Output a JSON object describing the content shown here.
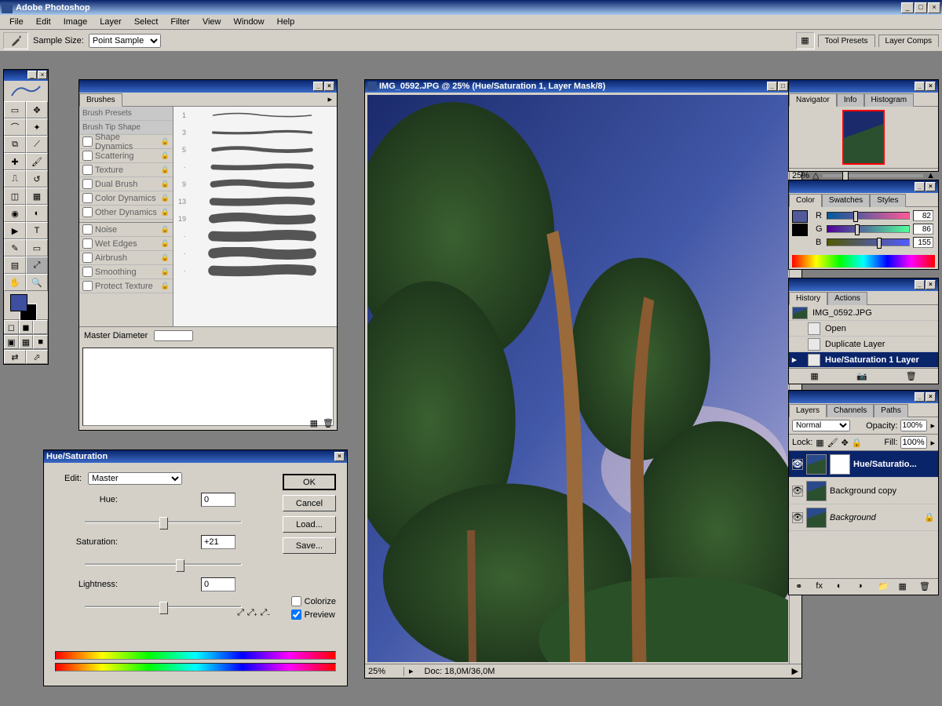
{
  "app": {
    "title": "Adobe Photoshop"
  },
  "menu": [
    "File",
    "Edit",
    "Image",
    "Layer",
    "Select",
    "Filter",
    "View",
    "Window",
    "Help"
  ],
  "optionsbar": {
    "sample_label": "Sample Size:",
    "sample_value": "Point Sample",
    "docked_tabs": [
      "Tool Presets",
      "Layer Comps"
    ]
  },
  "brushes": {
    "title": "Brushes",
    "presets_label": "Brush Presets",
    "tip_label": "Brush Tip Shape",
    "options": [
      "Shape Dynamics",
      "Scattering",
      "Texture",
      "Dual Brush",
      "Color Dynamics",
      "Other Dynamics"
    ],
    "options2": [
      "Noise",
      "Wet Edges",
      "Airbrush",
      "Smoothing",
      "Protect Texture"
    ],
    "sizes": [
      1,
      3,
      5,
      "·",
      9,
      13,
      19,
      "·",
      "·",
      "·"
    ],
    "master_label": "Master Diameter"
  },
  "document": {
    "title": "IMG_0592.JPG @ 25% (Hue/Saturation 1, Layer Mask/8)",
    "zoom": "25%",
    "docinfo": "Doc: 18,0M/36,0M"
  },
  "huesat": {
    "title": "Hue/Saturation",
    "edit_label": "Edit:",
    "edit_value": "Master",
    "hue_label": "Hue:",
    "hue_value": "0",
    "sat_label": "Saturation:",
    "sat_value": "+21",
    "light_label": "Lightness:",
    "light_value": "0",
    "ok": "OK",
    "cancel": "Cancel",
    "load": "Load...",
    "save": "Save...",
    "colorize": "Colorize",
    "preview": "Preview"
  },
  "navigator": {
    "tabs": [
      "Navigator",
      "Info",
      "Histogram"
    ],
    "zoom": "25%"
  },
  "color": {
    "tabs": [
      "Color",
      "Swatches",
      "Styles"
    ],
    "r_label": "R",
    "r_val": "82",
    "g_label": "G",
    "g_val": "86",
    "b_label": "B",
    "b_val": "155",
    "fg": "#525a9b",
    "bg": "#000000"
  },
  "history": {
    "tabs": [
      "History",
      "Actions"
    ],
    "doc": "IMG_0592.JPG",
    "items": [
      "Open",
      "Duplicate Layer",
      "Hue/Saturation 1 Layer"
    ]
  },
  "layers": {
    "tabs": [
      "Layers",
      "Channels",
      "Paths"
    ],
    "blend": "Normal",
    "opacity_label": "Opacity:",
    "opacity": "100%",
    "lock_label": "Lock:",
    "fill_label": "Fill:",
    "fill": "100%",
    "items": [
      {
        "name": "Hue/Saturatio...",
        "sel": true,
        "mask": true
      },
      {
        "name": "Background copy",
        "sel": false,
        "mask": false
      },
      {
        "name": "Background",
        "sel": false,
        "mask": false,
        "italic": true,
        "locked": true
      }
    ]
  }
}
